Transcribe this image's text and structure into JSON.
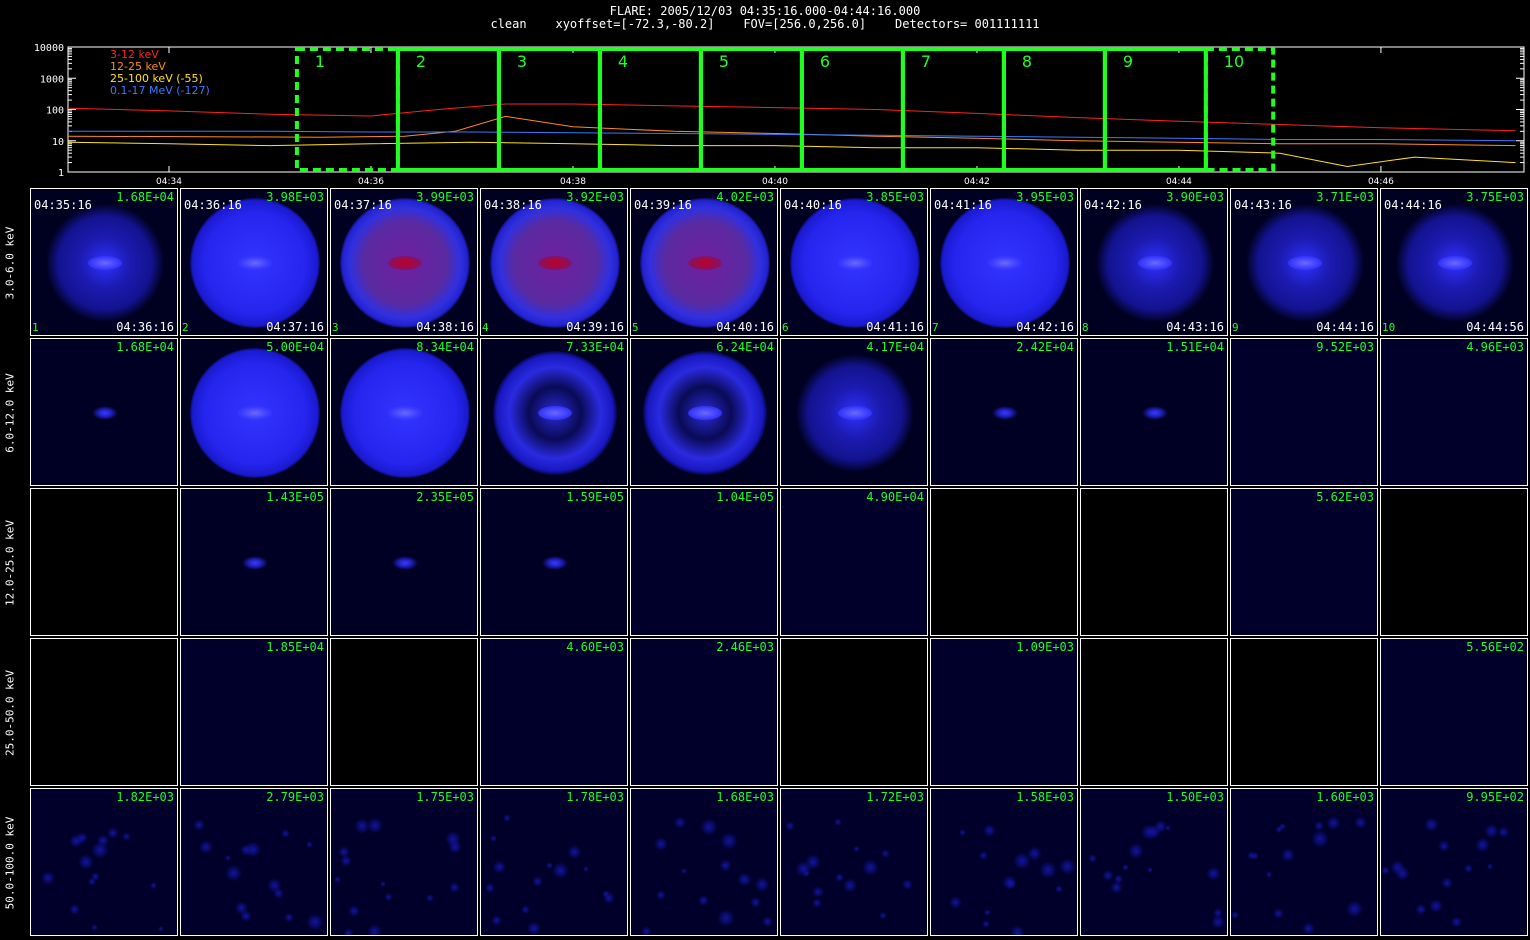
{
  "header": {
    "line1": "FLARE: 2005/12/03 04:35:16.000-04:44:16.000",
    "line2": "clean    xyoffset=[-72.3,-80.2]    FOV=[256.0,256.0]    Detectors= 001111111"
  },
  "chart_data": [
    {
      "type": "line",
      "y_scale": "log",
      "ylim": [
        1,
        10000
      ],
      "y_ticks": [
        "1",
        "10",
        "100",
        "1000",
        "10000"
      ],
      "x_ticks": [
        "04:34",
        "04:36",
        "04:38",
        "04:40",
        "04:42",
        "04:44",
        "04:46"
      ],
      "x_range": [
        "04:33:00",
        "04:47:25"
      ],
      "series": [
        {
          "name": "3-12 keV",
          "color": "#ff2020",
          "x": [
            "04:33:00",
            "04:34:00",
            "04:35:00",
            "04:36:00",
            "04:36:40",
            "04:37:20",
            "04:38:00",
            "04:39:00",
            "04:40:00",
            "04:41:00",
            "04:42:00",
            "04:43:00",
            "04:44:00",
            "04:45:00",
            "04:46:00",
            "04:47:20"
          ],
          "values": [
            110,
            90,
            70,
            62,
            100,
            150,
            150,
            130,
            115,
            100,
            75,
            55,
            42,
            33,
            26,
            21
          ]
        },
        {
          "name": "12-25 keV",
          "color": "#ff8c1a",
          "x": [
            "04:33:00",
            "04:35:30",
            "04:36:20",
            "04:36:50",
            "04:37:20",
            "04:38:00",
            "04:39:00",
            "04:40:00",
            "04:41:00",
            "04:42:00",
            "04:43:00",
            "04:44:00",
            "04:45:00",
            "04:46:00",
            "04:47:20"
          ],
          "values": [
            14,
            13,
            14,
            20,
            60,
            28,
            20,
            17,
            14,
            12,
            10,
            9,
            8,
            8,
            7
          ]
        },
        {
          "name": "25-100 keV (-55)",
          "color": "#ffe020",
          "x": [
            "04:33:00",
            "04:34:00",
            "04:35:00",
            "04:36:00",
            "04:37:00",
            "04:38:00",
            "04:39:00",
            "04:40:00",
            "04:41:00",
            "04:42:00",
            "04:43:00",
            "04:44:00",
            "04:45:00",
            "04:45:40",
            "04:46:20",
            "04:47:20"
          ],
          "values": [
            9,
            8,
            7,
            8,
            9,
            8,
            7,
            7,
            6,
            6,
            5,
            5,
            4,
            1.5,
            3,
            2
          ]
        },
        {
          "name": "0.1-17 MeV (-127)",
          "color": "#3a78ff",
          "x": [
            "04:33:00",
            "04:34:00",
            "04:35:00",
            "04:36:00",
            "04:37:00",
            "04:38:00",
            "04:39:00",
            "04:40:00",
            "04:41:00",
            "04:42:00",
            "04:43:00",
            "04:44:00",
            "04:45:00",
            "04:46:00",
            "04:47:20"
          ],
          "values": [
            20,
            20,
            20,
            19,
            19,
            18,
            17,
            16,
            15,
            14,
            13,
            12,
            11,
            11,
            10
          ]
        }
      ],
      "intervals": [
        {
          "label": "1",
          "start": "04:35:16",
          "end": "04:36:16"
        },
        {
          "label": "2",
          "start": "04:36:16",
          "end": "04:37:16"
        },
        {
          "label": "3",
          "start": "04:37:16",
          "end": "04:38:16"
        },
        {
          "label": "4",
          "start": "04:38:16",
          "end": "04:39:16"
        },
        {
          "label": "5",
          "start": "04:39:16",
          "end": "04:40:16"
        },
        {
          "label": "6",
          "start": "04:40:16",
          "end": "04:41:16"
        },
        {
          "label": "7",
          "start": "04:41:16",
          "end": "04:42:16"
        },
        {
          "label": "8",
          "start": "04:42:16",
          "end": "04:43:16"
        },
        {
          "label": "9",
          "start": "04:43:16",
          "end": "04:44:16"
        },
        {
          "label": "10",
          "start": "04:44:16",
          "end": "04:44:56"
        }
      ],
      "interval_color": "#20ff20"
    },
    {
      "type": "heatmap",
      "rows": [
        "3.0-6.0 keV",
        "6.0-12.0 keV",
        "12.0-25.0 keV",
        "25.0-50.0 keV",
        "50.0-100.0 keV"
      ],
      "columns": [
        {
          "idx": "1",
          "start": "04:35:16",
          "end": "04:36:16"
        },
        {
          "idx": "2",
          "start": "04:36:16",
          "end": "04:37:16"
        },
        {
          "idx": "3",
          "start": "04:37:16",
          "end": "04:38:16"
        },
        {
          "idx": "4",
          "start": "04:38:16",
          "end": "04:39:16"
        },
        {
          "idx": "5",
          "start": "04:39:16",
          "end": "04:40:16"
        },
        {
          "idx": "6",
          "start": "04:40:16",
          "end": "04:41:16"
        },
        {
          "idx": "7",
          "start": "04:41:16",
          "end": "04:42:16"
        },
        {
          "idx": "8",
          "start": "04:42:16",
          "end": "04:43:16"
        },
        {
          "idx": "9",
          "start": "04:43:16",
          "end": "04:44:16"
        },
        {
          "idx": "10",
          "start": "04:44:16",
          "end": "04:44:56"
        }
      ],
      "max_values": [
        [
          "1.68E+04",
          "3.98E+03",
          "3.99E+03",
          "3.92E+03",
          "4.02E+03",
          "3.85E+03",
          "3.95E+03",
          "3.90E+03",
          "3.71E+03",
          "3.75E+03"
        ],
        [
          "1.68E+04",
          "5.00E+04",
          "8.34E+04",
          "7.33E+04",
          "6.24E+04",
          "4.17E+04",
          "2.42E+04",
          "1.51E+04",
          "9.52E+03",
          "4.96E+03"
        ],
        [
          "",
          "1.43E+05",
          "2.35E+05",
          "1.59E+05",
          "1.04E+05",
          "4.90E+04",
          "",
          "",
          "5.62E+03",
          ""
        ],
        [
          "",
          "1.85E+04",
          "",
          "4.60E+03",
          "2.46E+03",
          "",
          "1.09E+03",
          "",
          "",
          "5.56E+02"
        ],
        [
          "1.82E+03",
          "2.79E+03",
          "1.75E+03",
          "1.78E+03",
          "1.68E+03",
          "1.72E+03",
          "1.58E+03",
          "1.50E+03",
          "1.60E+03",
          "9.95E+02"
        ]
      ],
      "cell_style": [
        [
          "faint-ring",
          "ring",
          "ring-red",
          "ring-red",
          "ring-red",
          "ring",
          "ring",
          "faint-ring",
          "faint-ring",
          "faint-ring"
        ],
        [
          "dot",
          "ring",
          "ring",
          "ring-dark",
          "ring-dark",
          "faint-ring",
          "dot",
          "dot",
          "empty",
          "empty"
        ],
        [
          "blank",
          "dot",
          "dot",
          "dot",
          "empty",
          "empty",
          "blank",
          "blank",
          "empty",
          "blank"
        ],
        [
          "blank",
          "empty",
          "blank",
          "empty",
          "empty",
          "blank",
          "empty",
          "blank",
          "blank",
          "empty"
        ],
        [
          "noise",
          "noise",
          "noise",
          "noise",
          "noise",
          "noise",
          "noise",
          "noise",
          "noise",
          "noise"
        ]
      ]
    }
  ]
}
